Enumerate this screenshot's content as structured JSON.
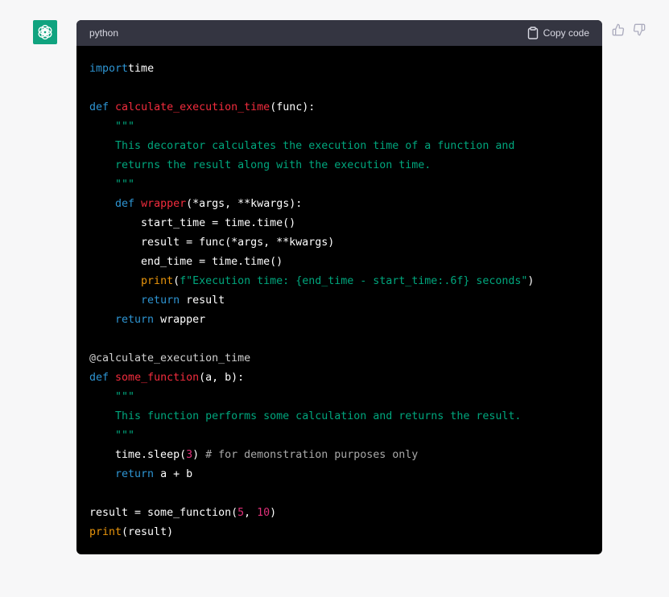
{
  "code_block": {
    "language": "python",
    "copy_label": "Copy code"
  },
  "code_lines": [
    [
      [
        "kw",
        "import"
      ],
      [
        "",
        "time"
      ]
    ],
    [],
    [
      [
        "kw",
        "def"
      ],
      [
        "",
        " "
      ],
      [
        "fn",
        "calculate_execution_time"
      ],
      [
        "",
        "(func):"
      ]
    ],
    [
      [
        "",
        "    "
      ],
      [
        "str",
        "\"\"\""
      ]
    ],
    [
      [
        "",
        "    "
      ],
      [
        "str",
        "This decorator calculates the execution time of a function and"
      ]
    ],
    [
      [
        "",
        "    "
      ],
      [
        "str",
        "returns the result along with the execution time."
      ]
    ],
    [
      [
        "",
        "    "
      ],
      [
        "str",
        "\"\"\""
      ]
    ],
    [
      [
        "",
        "    "
      ],
      [
        "kw",
        "def"
      ],
      [
        "",
        " "
      ],
      [
        "fn",
        "wrapper"
      ],
      [
        "",
        "(*args, **kwargs):"
      ]
    ],
    [
      [
        "",
        "        start_time = time.time()"
      ]
    ],
    [
      [
        "",
        "        result = func(*args, **kwargs)"
      ]
    ],
    [
      [
        "",
        "        end_time = time.time()"
      ]
    ],
    [
      [
        "",
        "        "
      ],
      [
        "bi",
        "print"
      ],
      [
        "",
        "("
      ],
      [
        "str",
        "f\"Execution time: {end_time - start_time:.6f} seconds\""
      ],
      [
        "",
        ")"
      ]
    ],
    [
      [
        "",
        "        "
      ],
      [
        "kw",
        "return"
      ],
      [
        "",
        " result"
      ]
    ],
    [
      [
        "",
        "    "
      ],
      [
        "kw",
        "return"
      ],
      [
        "",
        " wrapper"
      ]
    ],
    [],
    [
      [
        "dec",
        "@calculate_execution_time"
      ]
    ],
    [
      [
        "kw",
        "def"
      ],
      [
        "",
        " "
      ],
      [
        "fn",
        "some_function"
      ],
      [
        "",
        "(a, b):"
      ]
    ],
    [
      [
        "",
        "    "
      ],
      [
        "str",
        "\"\"\""
      ]
    ],
    [
      [
        "",
        "    "
      ],
      [
        "str",
        "This function performs some calculation and returns the result."
      ]
    ],
    [
      [
        "",
        "    "
      ],
      [
        "str",
        "\"\"\""
      ]
    ],
    [
      [
        "",
        "    time.sleep("
      ],
      [
        "num",
        "3"
      ],
      [
        "",
        ") "
      ],
      [
        "cm",
        "# for demonstration purposes only"
      ]
    ],
    [
      [
        "",
        "    "
      ],
      [
        "kw",
        "return"
      ],
      [
        "",
        " a + b"
      ]
    ],
    [],
    [
      [
        "",
        "result = some_function("
      ],
      [
        "num",
        "5"
      ],
      [
        "",
        ", "
      ],
      [
        "num",
        "10"
      ],
      [
        "",
        ")"
      ]
    ],
    [
      [
        "bi",
        "print"
      ],
      [
        "",
        "(result)"
      ]
    ]
  ],
  "colors": {
    "keyword": "#2e95d3",
    "function_name": "#f22c3d",
    "string": "#00a67d",
    "number": "#df3079",
    "builtin": "#e9950c",
    "comment": "#a9a9a9",
    "avatar_bg": "#10a37f"
  },
  "icons": {
    "avatar": "openai-logo-icon",
    "copy": "clipboard-icon",
    "like": "thumbs-up-icon",
    "dislike": "thumbs-down-icon"
  }
}
